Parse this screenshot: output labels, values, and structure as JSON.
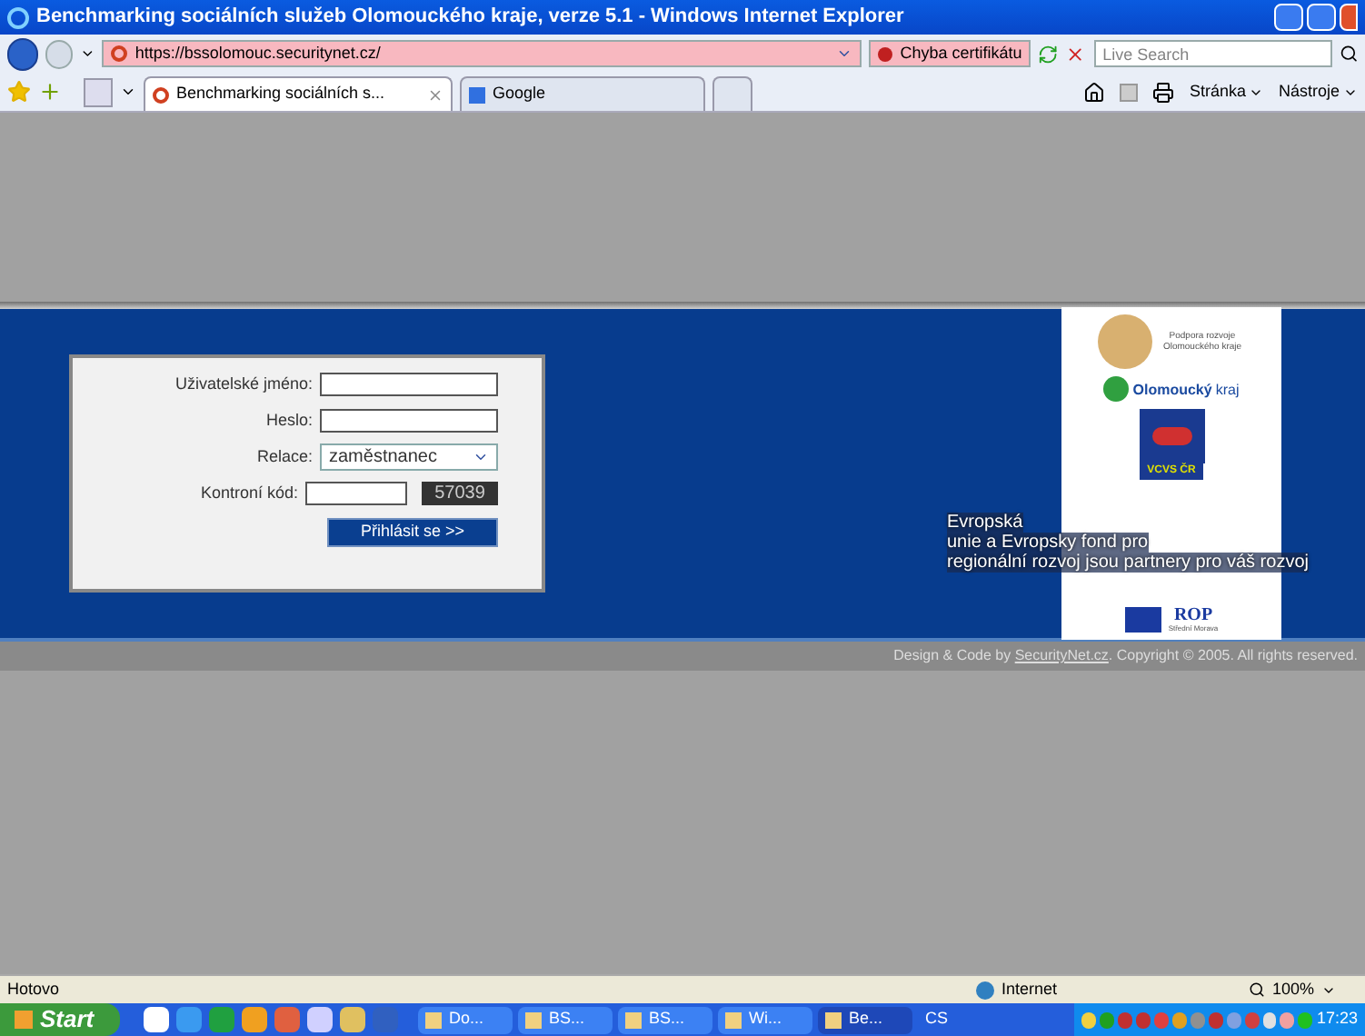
{
  "window": {
    "title": "Benchmarking sociálních služeb Olomouckého kraje, verze 5.1 - Windows Internet Explorer"
  },
  "address_bar": {
    "url": "https://bssolomouc.securitynet.cz/",
    "certificate_error": "Chyba certifikátu",
    "search_placeholder": "Live Search"
  },
  "tabs": [
    {
      "label": "Benchmarking sociálních s...",
      "selected": true
    },
    {
      "label": "Google",
      "selected": false
    }
  ],
  "command_bar": [
    "Stránka",
    "Nástroje"
  ],
  "login": {
    "fields": [
      {
        "kind": "text",
        "label": "Uživatelské jméno:"
      },
      {
        "kind": "password",
        "label": "Heslo:"
      },
      {
        "kind": "select",
        "label": "Relace:",
        "value": "zaměstnanec"
      },
      {
        "kind": "captcha",
        "label": "Kontroní kód:",
        "code": "57039"
      }
    ],
    "submit": "Přihlásit se >>"
  },
  "logos": {
    "podpora": "Podpora rozvoje Olomouckého kraje",
    "olomoucky": "Olomoucký",
    "kraj": "kraj",
    "vcvs": "VCVS ČR",
    "rop": "ROP",
    "rop_sub": "Střední Morava"
  },
  "overlay_text": [
    "Evropská",
    "unie a Evropsky fond pro",
    "regionální rozvoj jsou partnery pro váš rozvoj"
  ],
  "footer": {
    "prefix": "Design & Code by ",
    "link": "SecurityNet.cz",
    "suffix": ". Copyright © 2005. All rights reserved."
  },
  "status_bar": {
    "text": "Hotovo",
    "zone": "Internet",
    "zoom": "100%"
  },
  "taskbar": {
    "start": "Start",
    "items": [
      {
        "label": "Do...",
        "selected": false
      },
      {
        "label": "BS...",
        "selected": false
      },
      {
        "label": "BS...",
        "selected": false
      },
      {
        "label": "Wi...",
        "selected": false
      },
      {
        "label": "Be...",
        "selected": true
      }
    ],
    "language": "CS",
    "clock": "17:23"
  }
}
